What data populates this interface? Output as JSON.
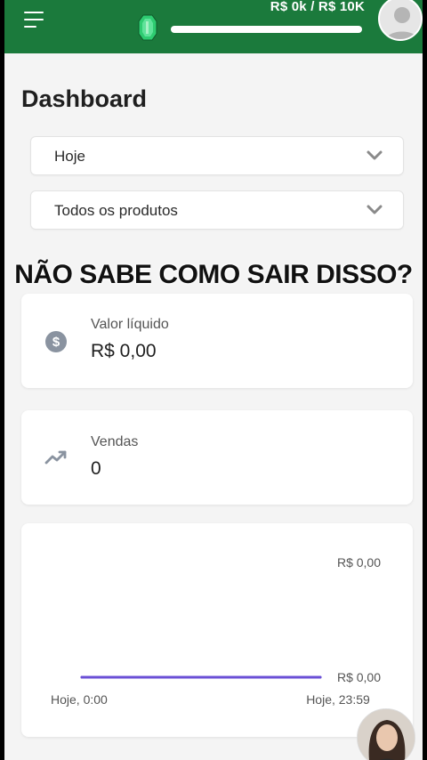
{
  "header": {
    "progress_label": "R$ 0k / R$ 10K",
    "progress_value": 0.0,
    "menu_icon": "hamburger-icon",
    "gem_icon": "emerald-gem-icon",
    "user_icon": "user-avatar-icon"
  },
  "page": {
    "title": "Dashboard"
  },
  "filters": {
    "period": "Hoje",
    "products": "Todos os produtos"
  },
  "overlay": {
    "caption": "NÃO SABE COMO SAIR DISSO?"
  },
  "cards": {
    "net_value": {
      "title": "Valor líquido",
      "value": "R$ 0,00",
      "icon": "dollar-coin-icon"
    },
    "sales": {
      "title": "Vendas",
      "value": "0",
      "icon": "trending-up-icon"
    }
  },
  "chart_data": {
    "type": "line",
    "x": [
      "Hoje, 0:00",
      "Hoje, 23:59"
    ],
    "series": [
      {
        "values": [
          0,
          0
        ]
      }
    ],
    "y_tick_labels": [
      "R$ 0,00",
      "R$ 0,00"
    ],
    "ylim": [
      0,
      0
    ],
    "x_tick_labels": [
      "Hoje, 0:00",
      "Hoje, 23:59"
    ],
    "grid": false,
    "line_color": "#6a4fd6"
  },
  "colors": {
    "brand_green": "#1b7a3c",
    "progress_fill": "#2ecc71",
    "gem": "#2ecc71"
  }
}
